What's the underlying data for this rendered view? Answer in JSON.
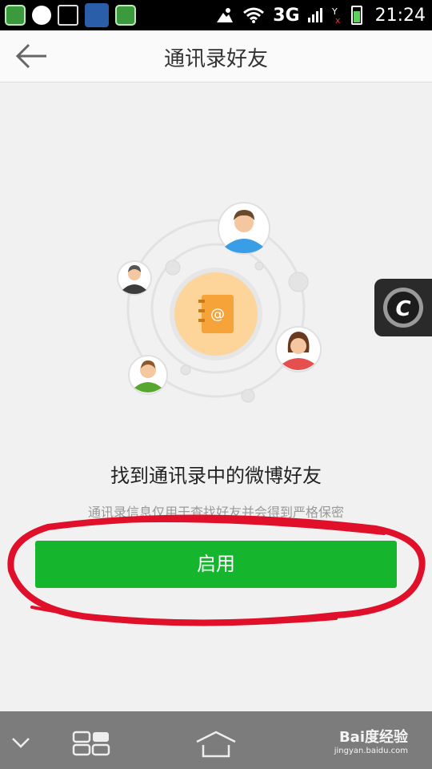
{
  "status_bar": {
    "network": "3G",
    "time": "21:24",
    "left_icons": [
      "shield-icon",
      "disc-icon",
      "gallery-icon",
      "weather-icon",
      "security-icon"
    ]
  },
  "header": {
    "title": "通讯录好友",
    "back_icon": "back-arrow-icon"
  },
  "main": {
    "headline": "找到通讯录中的微博好友",
    "description": "通讯录信息仅用于查找好友并会得到严格保密",
    "enable_button": "启用",
    "illustration_icon": "address-book-icon"
  },
  "floating_button": {
    "letter": "C"
  },
  "watermark": {
    "brand": "Bai度经验",
    "url": "jingyan.baidu.com"
  },
  "colors": {
    "accent_green": "#15b62e",
    "annotation_red": "#e0102a",
    "book_orange": "#f6a43a"
  }
}
